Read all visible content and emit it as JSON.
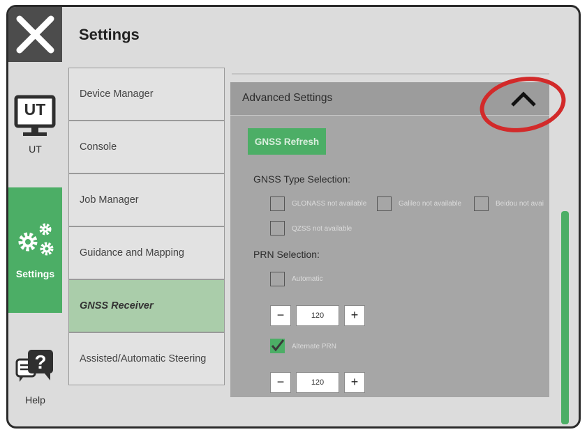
{
  "app": {
    "title": "Settings"
  },
  "rail": {
    "ut_label": "UT",
    "ut_screen_text": "UT",
    "settings_label": "Settings",
    "help_label": "Help"
  },
  "menu": {
    "items": [
      {
        "label": "Device Manager"
      },
      {
        "label": "Console"
      },
      {
        "label": "Job Manager"
      },
      {
        "label": "Guidance and Mapping"
      },
      {
        "label": "GNSS Receiver",
        "active": true
      },
      {
        "label": "Assisted/Automatic Steering"
      }
    ]
  },
  "panel": {
    "header": "Advanced Settings",
    "refresh_button": "GNSS Refresh",
    "gnss_type_label": "GNSS Type Selection:",
    "gnss_types": [
      {
        "label": "GLONASS not available",
        "checked": false
      },
      {
        "label": "Galileo not available",
        "checked": false
      },
      {
        "label": "Beidou not avai",
        "checked": false
      },
      {
        "label": "QZSS not available",
        "checked": false
      }
    ],
    "prn_label": "PRN Selection:",
    "automatic": {
      "label": "Automatic",
      "checked": false
    },
    "prn_value_1": "120",
    "alternate_prn": {
      "label": "Alternate PRN",
      "checked": true
    },
    "prn_value_2": "120",
    "minus": "−",
    "plus": "+"
  },
  "colors": {
    "accent": "#4cae66",
    "panel": "#a6a6a6",
    "annotation": "#d22a2a"
  }
}
